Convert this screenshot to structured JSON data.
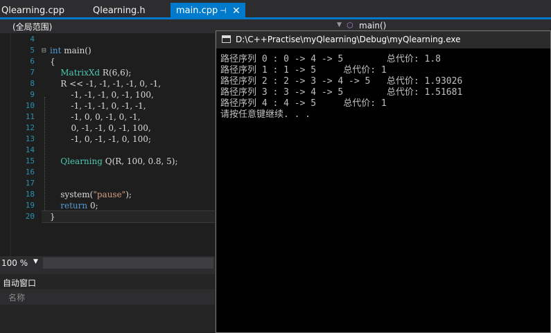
{
  "tabs": [
    {
      "label": "Qlearning.cpp"
    },
    {
      "label": "Qlearning.h"
    },
    {
      "label": "main.cpp"
    }
  ],
  "nav": {
    "scope": "(全局范围)",
    "function": "main()"
  },
  "code": {
    "line_numbers": [
      "4",
      "5",
      "6",
      "7",
      "8",
      "9",
      "10",
      "11",
      "12",
      "13",
      "14",
      "15",
      "16",
      "17",
      "18",
      "19",
      "20"
    ],
    "lines": [
      "",
      "int main()",
      "{",
      "    MatrixXd R(6,6);",
      "    R << -1, -1, -1, -1, 0, -1,",
      "        -1, -1, -1, 0, -1, 100,",
      "        -1, -1, -1, 0, -1, -1,",
      "        -1, 0, 0, -1, 0, -1,",
      "        0, -1, -1, 0, -1, 100,",
      "        -1, 0, -1, -1, 0, 100;",
      "",
      "    Qlearning Q(R, 100, 0.8, 5);",
      "",
      "",
      "    system(\"pause\");",
      "    return 0;",
      "}"
    ]
  },
  "zoom": "100 %",
  "auto_window": {
    "title": "自动窗口",
    "column": "名称"
  },
  "console": {
    "title": "D:\\C++Practise\\myQlearning\\Debug\\myQlearning.exe",
    "lines": [
      "路径序列 0 : 0 -> 4 -> 5        总代价: 1.8",
      "路径序列 1 : 1 -> 5     总代价: 1",
      "路径序列 2 : 2 -> 3 -> 4 -> 5   总代价: 1.93026",
      "路径序列 3 : 3 -> 4 -> 5        总代价: 1.51681",
      "路径序列 4 : 4 -> 5     总代价: 1",
      "请按任意键继续. . ."
    ]
  }
}
